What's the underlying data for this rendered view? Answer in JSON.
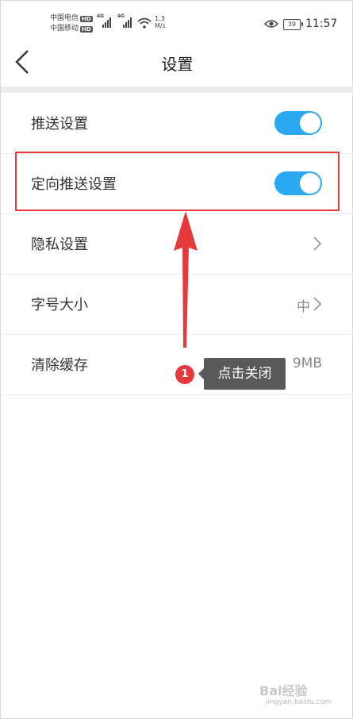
{
  "status_bar": {
    "carrier1": "中国电信",
    "carrier2": "中国移动",
    "hd": "HD",
    "net1": "4G",
    "net2": "4G",
    "speed_value": "1.3",
    "speed_unit": "M/s",
    "battery": "39",
    "time": "11:57"
  },
  "nav": {
    "title": "设置",
    "back_icon": "chevron-left-icon"
  },
  "rows": [
    {
      "label": "推送设置",
      "control": "toggle",
      "on": true
    },
    {
      "label": "定向推送设置",
      "control": "toggle",
      "on": true
    },
    {
      "label": "隐私设置",
      "control": "chevron"
    },
    {
      "label": "字号大小",
      "value": "中",
      "control": "chevron"
    },
    {
      "label": "清除缓存",
      "value": "9MB"
    }
  ],
  "annotation": {
    "badge": "1",
    "tip": "点击关闭",
    "highlight_color": "#e5393b"
  },
  "colors": {
    "toggle_on": "#2aa9f2",
    "accent_red": "#e5393b"
  },
  "watermark": {
    "text": "Bai经验",
    "url": "jingyan.baidu.com"
  }
}
